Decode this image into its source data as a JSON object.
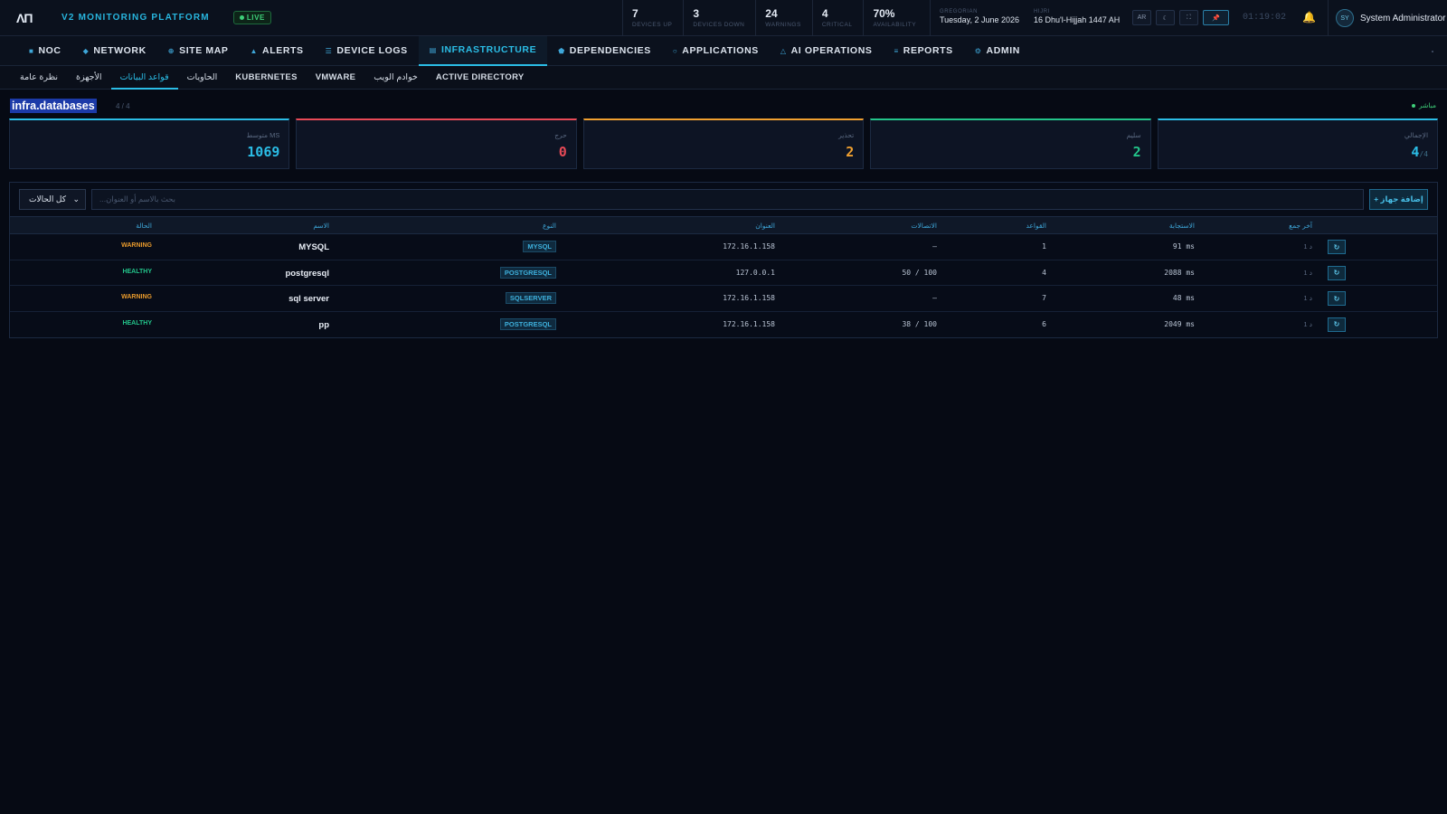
{
  "topbar": {
    "logo": "ΛΠ",
    "brand": "V2 MONITORING PLATFORM",
    "live": "LIVE",
    "stats": [
      {
        "num": "7",
        "label": "DEVICES UP"
      },
      {
        "num": "3",
        "label": "DEVICES DOWN"
      },
      {
        "num": "24",
        "label": "WARNINGS"
      },
      {
        "num": "4",
        "label": "CRITICAL"
      },
      {
        "num": "70%",
        "label": "AVAILABILITY"
      }
    ],
    "gregorian_label": "GREGORIAN",
    "gregorian_value": "Tuesday, 2 June 2026",
    "hijri_label": "HIJRI",
    "hijri_value": "16 Dhu'l-Hijjah 1447 AH",
    "lang_button": "AR",
    "theme_icon": "moon-icon",
    "fullscreen_icon": "fullscreen-icon",
    "pin_icon": "pin-icon",
    "clock": "01:19:02",
    "bell_icon": "bell-icon",
    "user_initials": "SY",
    "user_name": "System Administrator"
  },
  "nav": [
    {
      "label": "NOC",
      "icon": "■"
    },
    {
      "label": "NETWORK",
      "icon": "◆"
    },
    {
      "label": "SITE MAP",
      "icon": "⊕"
    },
    {
      "label": "ALERTS",
      "icon": "▲"
    },
    {
      "label": "DEVICE LOGS",
      "icon": "☰"
    },
    {
      "label": "INFRASTRUCTURE",
      "icon": "▤"
    },
    {
      "label": "DEPENDENCIES",
      "icon": "⬟"
    },
    {
      "label": "APPLICATIONS",
      "icon": "○"
    },
    {
      "label": "AI OPERATIONS",
      "icon": "△"
    },
    {
      "label": "REPORTS",
      "icon": "≡"
    },
    {
      "label": "ADMIN",
      "icon": "⚙"
    }
  ],
  "subnav": [
    "نظرة عامة",
    "الأجهزة",
    "قواعد البيانات",
    "الحاويات",
    "KUBERNETES",
    "VMWARE",
    "خوادم الويب",
    "ACTIVE DIRECTORY"
  ],
  "page": {
    "title": "infra.databases",
    "count": "4 / 4",
    "live_label": "مباشر"
  },
  "cards": [
    {
      "label": "متوسط MS",
      "value": "1069",
      "sub": "",
      "color": "#2bbde6"
    },
    {
      "label": "حرج",
      "value": "0",
      "sub": "",
      "color": "#e84a57"
    },
    {
      "label": "تحذير",
      "value": "2",
      "sub": "",
      "color": "#f0a030"
    },
    {
      "label": "سليم",
      "value": "2",
      "sub": "",
      "color": "#23c48a"
    },
    {
      "label": "الإجمالي",
      "value": "4",
      "sub": "/4",
      "color": "#2bbde6"
    }
  ],
  "toolbar": {
    "filter_value": "كل الحالات",
    "search_placeholder": "...بحث بالاسم أو العنوان",
    "add_button": "+ إضافة جهاز"
  },
  "table": {
    "headers": [
      "الحالة",
      "الاسم",
      "النوع",
      "العنوان",
      "الاتصالات",
      "القواعد",
      "الاستجابة",
      "آخر جمع"
    ],
    "rows": [
      {
        "status": "WARNING",
        "status_color": "#e89a2c",
        "name": "MYSQL",
        "type": "MYSQL",
        "address": "172.16.1.158",
        "connections": "—",
        "databases": "1",
        "response": "91 ms",
        "last": "1 د"
      },
      {
        "status": "HEALTHY",
        "status_color": "#23c48a",
        "name": "postgresql",
        "type": "POSTGRESQL",
        "address": "127.0.0.1",
        "connections": "50 / 100",
        "databases": "4",
        "response": "2088 ms",
        "last": "1 د"
      },
      {
        "status": "WARNING",
        "status_color": "#e89a2c",
        "name": "sql server",
        "type": "SQLSERVER",
        "address": "172.16.1.158",
        "connections": "—",
        "databases": "7",
        "response": "48 ms",
        "last": "1 د"
      },
      {
        "status": "HEALTHY",
        "status_color": "#23c48a",
        "name": "pp",
        "type": "POSTGRESQL",
        "address": "172.16.1.158",
        "connections": "38 / 100",
        "databases": "6",
        "response": "2049 ms",
        "last": "1 د"
      }
    ]
  }
}
